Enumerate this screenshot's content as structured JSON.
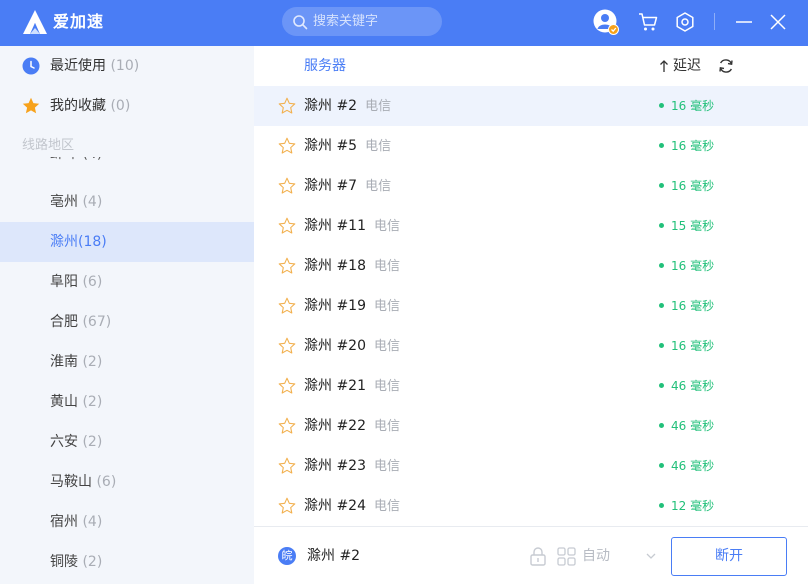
{
  "app": {
    "name": "爱加速"
  },
  "search": {
    "placeholder": "搜索关键字"
  },
  "sidebar": {
    "recent": {
      "label": "最近使用",
      "count": "(10)"
    },
    "favorites": {
      "label": "我的收藏",
      "count": "(0)"
    },
    "section_label": "线路地区",
    "regions": [
      {
        "label": "亳州",
        "count": "(4)"
      },
      {
        "label": "滁州",
        "count": "(18)",
        "active": true
      },
      {
        "label": "阜阳",
        "count": "(6)"
      },
      {
        "label": "合肥",
        "count": "(67)"
      },
      {
        "label": "淮南",
        "count": "(2)"
      },
      {
        "label": "黄山",
        "count": "(2)"
      },
      {
        "label": "六安",
        "count": "(2)"
      },
      {
        "label": "马鞍山",
        "count": "(6)"
      },
      {
        "label": "宿州",
        "count": "(4)"
      },
      {
        "label": "铜陵",
        "count": "(2)"
      }
    ]
  },
  "list": {
    "header": {
      "server": "服务器",
      "latency": "延迟"
    },
    "rows": [
      {
        "name": "滁州 #2",
        "isp": "电信",
        "latency": "16 毫秒",
        "selected": true
      },
      {
        "name": "滁州 #5",
        "isp": "电信",
        "latency": "16 毫秒"
      },
      {
        "name": "滁州 #7",
        "isp": "电信",
        "latency": "16 毫秒"
      },
      {
        "name": "滁州 #11",
        "isp": "电信",
        "latency": "15 毫秒"
      },
      {
        "name": "滁州 #18",
        "isp": "电信",
        "latency": "16 毫秒"
      },
      {
        "name": "滁州 #19",
        "isp": "电信",
        "latency": "16 毫秒"
      },
      {
        "name": "滁州 #20",
        "isp": "电信",
        "latency": "16 毫秒"
      },
      {
        "name": "滁州 #21",
        "isp": "电信",
        "latency": "46 毫秒"
      },
      {
        "name": "滁州 #22",
        "isp": "电信",
        "latency": "46 毫秒"
      },
      {
        "name": "滁州 #23",
        "isp": "电信",
        "latency": "46 毫秒"
      },
      {
        "name": "滁州 #24",
        "isp": "电信",
        "latency": "12 毫秒"
      }
    ]
  },
  "bottom": {
    "badge": "皖",
    "current_server": "滁州 #2",
    "mode": "自动",
    "disconnect": "断开"
  },
  "icons": {
    "logo": "logo-icon",
    "search": "search-icon",
    "avatar": "avatar-icon",
    "cart": "cart-icon",
    "settings": "gear-icon",
    "minimize": "minimize-icon",
    "close": "close-icon",
    "recent": "clock-icon",
    "favorites": "star-filled-icon",
    "row_star": "star-outline-icon",
    "sort": "sort-up-icon",
    "refresh": "refresh-icon",
    "lock": "lock-icon",
    "mode": "grid-icon",
    "dropdown": "chevron-down-icon"
  },
  "colors": {
    "accent": "#4a7df5",
    "sidebar_bg": "#f3f6fb",
    "active_region_bg": "#dde7fb",
    "selected_row_bg": "#eef3fd",
    "latency_green": "#22c07a",
    "favorite_orange": "#f7a21b"
  }
}
